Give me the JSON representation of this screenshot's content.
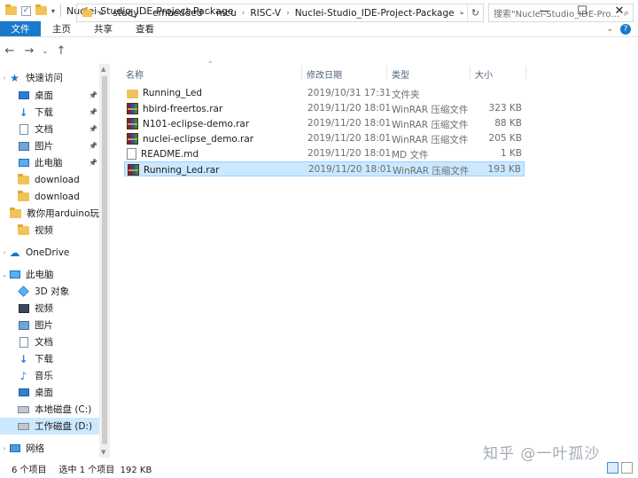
{
  "window": {
    "title": "Nuclei-Studio_IDE-Project-Package",
    "controls": {
      "minimize": "—",
      "maximize": "☐",
      "close": "✕"
    }
  },
  "ribbon": {
    "tabs": [
      "文件",
      "主页",
      "共享",
      "查看"
    ]
  },
  "address_bar": {
    "prefix": "«",
    "crumbs": [
      "study",
      "embedded",
      "mcu",
      "RISC-V",
      "Nuclei-Studio_IDE-Project-Package"
    ],
    "separator": "›"
  },
  "search": {
    "placeholder": "搜索\"Nuclei-Studio_IDE-Pro..."
  },
  "sidebar": {
    "items": [
      {
        "label": "快速访问",
        "icon": "star-icon",
        "level": 0,
        "expand": "›",
        "pinned": false,
        "selected": false
      },
      {
        "label": "桌面",
        "icon": "desktop-icon",
        "level": 1,
        "pinned": true,
        "selected": false
      },
      {
        "label": "下载",
        "icon": "download-icon",
        "level": 1,
        "pinned": true,
        "selected": false
      },
      {
        "label": "文档",
        "icon": "document-icon",
        "level": 1,
        "pinned": true,
        "selected": false
      },
      {
        "label": "图片",
        "icon": "pictures-icon",
        "level": 1,
        "pinned": true,
        "selected": false
      },
      {
        "label": "此电脑",
        "icon": "pc-icon",
        "level": 1,
        "pinned": true,
        "selected": false
      },
      {
        "label": "download",
        "icon": "folder-icon",
        "level": 1,
        "pinned": false,
        "selected": false
      },
      {
        "label": "download",
        "icon": "folder-icon",
        "level": 1,
        "pinned": false,
        "selected": false
      },
      {
        "label": "教你用arduino玩",
        "icon": "folder-icon",
        "level": 1,
        "pinned": false,
        "selected": false
      },
      {
        "label": "视频",
        "icon": "folder-icon",
        "level": 1,
        "pinned": false,
        "selected": false
      },
      {
        "label": "OneDrive",
        "icon": "onedrive-icon",
        "level": 0,
        "expand": "›",
        "pinned": false,
        "selected": false
      },
      {
        "label": "此电脑",
        "icon": "pc-icon",
        "level": 0,
        "expand": "⌄",
        "pinned": false,
        "selected": false
      },
      {
        "label": "3D 对象",
        "icon": "3d-objects-icon",
        "level": 1,
        "pinned": false,
        "selected": false
      },
      {
        "label": "视频",
        "icon": "video-icon",
        "level": 1,
        "pinned": false,
        "selected": false
      },
      {
        "label": "图片",
        "icon": "pictures-icon",
        "level": 1,
        "pinned": false,
        "selected": false
      },
      {
        "label": "文档",
        "icon": "document-icon",
        "level": 1,
        "pinned": false,
        "selected": false
      },
      {
        "label": "下载",
        "icon": "download-icon",
        "level": 1,
        "pinned": false,
        "selected": false
      },
      {
        "label": "音乐",
        "icon": "music-icon",
        "level": 1,
        "pinned": false,
        "selected": false
      },
      {
        "label": "桌面",
        "icon": "desktop-icon",
        "level": 1,
        "pinned": false,
        "selected": false
      },
      {
        "label": "本地磁盘 (C:)",
        "icon": "drive-icon",
        "level": 1,
        "pinned": false,
        "selected": false
      },
      {
        "label": "工作磁盘 (D:)",
        "icon": "drive-icon",
        "level": 1,
        "pinned": false,
        "selected": true
      },
      {
        "label": "网络",
        "icon": "network-icon",
        "level": 0,
        "expand": "›",
        "pinned": false,
        "selected": false
      }
    ]
  },
  "file_list": {
    "columns": {
      "name": "名称",
      "modified": "修改日期",
      "type": "类型",
      "size": "大小"
    },
    "rows": [
      {
        "name": "Running_Led",
        "modified": "2019/10/31 17:31",
        "type": "文件夹",
        "size": "",
        "icon": "folder-icon",
        "selected": false
      },
      {
        "name": "hbird-freertos.rar",
        "modified": "2019/11/20 18:01",
        "type": "WinRAR 压缩文件",
        "size": "323 KB",
        "icon": "rar-archive-icon",
        "selected": false
      },
      {
        "name": "N101-eclipse-demo.rar",
        "modified": "2019/11/20 18:01",
        "type": "WinRAR 压缩文件",
        "size": "88 KB",
        "icon": "rar-archive-icon",
        "selected": false
      },
      {
        "name": "nuclei-eclipse_demo.rar",
        "modified": "2019/11/20 18:01",
        "type": "WinRAR 压缩文件",
        "size": "205 KB",
        "icon": "rar-archive-icon",
        "selected": false
      },
      {
        "name": "README.md",
        "modified": "2019/11/20 18:01",
        "type": "MD 文件",
        "size": "1 KB",
        "icon": "text-file-icon",
        "selected": false
      },
      {
        "name": "Running_Led.rar",
        "modified": "2019/11/20 18:01",
        "type": "WinRAR 压缩文件",
        "size": "193 KB",
        "icon": "rar-archive-icon",
        "selected": true
      }
    ]
  },
  "status_bar": {
    "item_count": "6 个项目",
    "selection": "选中 1 个项目  192 KB"
  },
  "watermark": "知乎 @一叶孤沙"
}
